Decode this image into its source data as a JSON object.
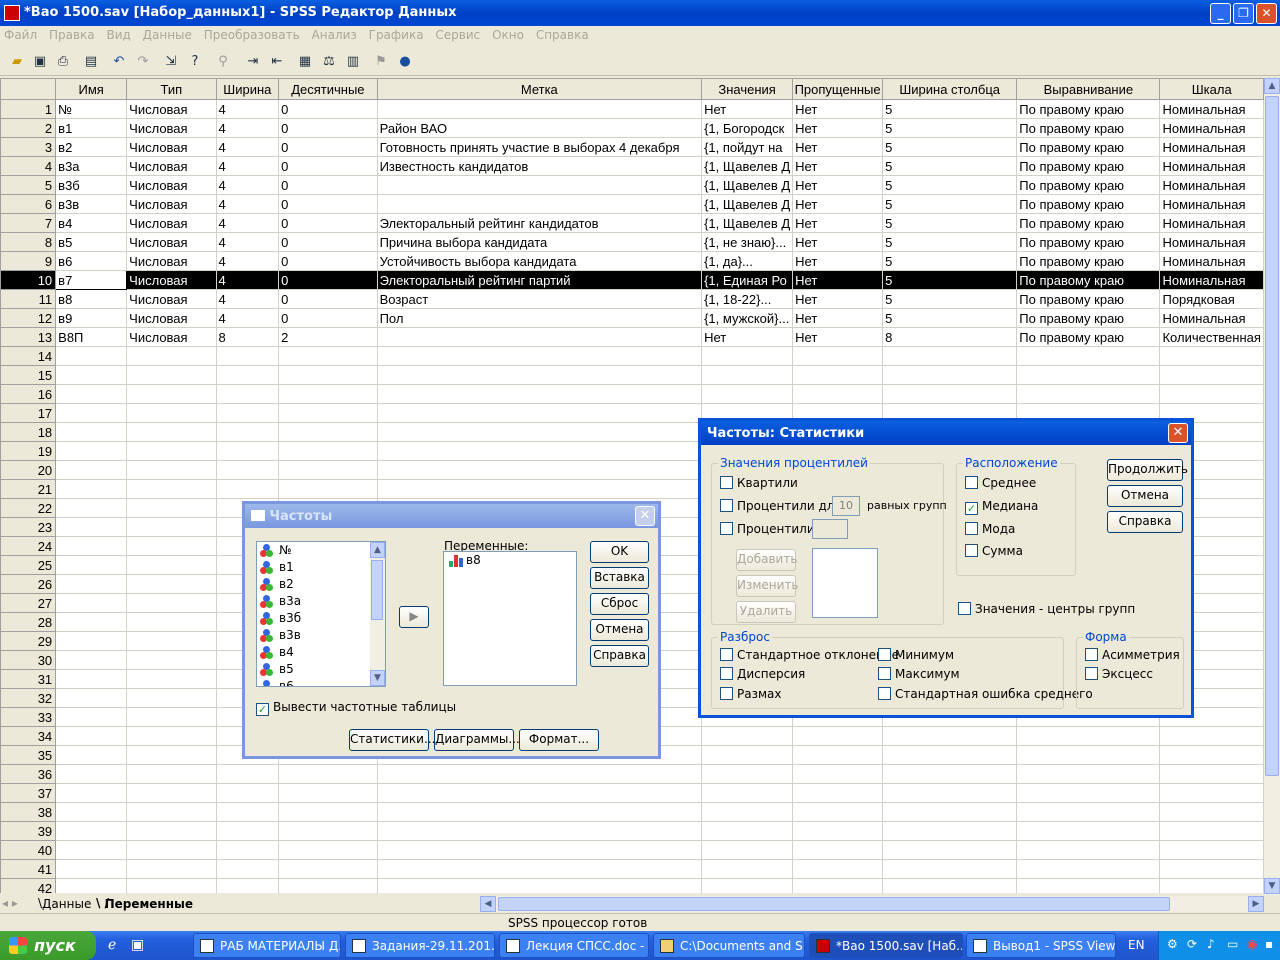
{
  "window": {
    "title": "*Вао 1500.sav [Набор_данных1] - SPSS Редактор Данных"
  },
  "menu": [
    "Файл",
    "Правка",
    "Вид",
    "Данные",
    "Преобразовать",
    "Анализ",
    "Графика",
    "Сервис",
    "Окно",
    "Справка"
  ],
  "grid": {
    "columns": [
      "Имя",
      "Тип",
      "Ширина",
      "Десятичные",
      "Метка",
      "Значения",
      "Пропущенные",
      "Ширина столбца",
      "Выравнивание",
      "Шкала"
    ],
    "rows": [
      [
        "1",
        "№",
        "Числовая",
        "4",
        "0",
        "",
        "Нет",
        "Нет",
        "5",
        "По правому краю",
        "Номинальная"
      ],
      [
        "2",
        "в1",
        "Числовая",
        "4",
        "0",
        "Район ВАО",
        "{1, Богородск",
        "Нет",
        "5",
        "По правому краю",
        "Номинальная"
      ],
      [
        "3",
        "в2",
        "Числовая",
        "4",
        "0",
        "Готовность принять участие в выборах 4 декабря",
        "{1, пойдут на",
        "Нет",
        "5",
        "По правому краю",
        "Номинальная"
      ],
      [
        "4",
        "в3а",
        "Числовая",
        "4",
        "0",
        "Известность  кандидатов",
        "{1, Щавелев Д",
        "Нет",
        "5",
        "По правому краю",
        "Номинальная"
      ],
      [
        "5",
        "в3б",
        "Числовая",
        "4",
        "0",
        "",
        "{1, Щавелев Д",
        "Нет",
        "5",
        "По правому краю",
        "Номинальная"
      ],
      [
        "6",
        "в3в",
        "Числовая",
        "4",
        "0",
        "",
        "{1, Щавелев Д",
        "Нет",
        "5",
        "По правому краю",
        "Номинальная"
      ],
      [
        "7",
        "в4",
        "Числовая",
        "4",
        "0",
        "Электоральный рейтинг кандидатов",
        "{1, Щавелев Д",
        "Нет",
        "5",
        "По правому краю",
        "Номинальная"
      ],
      [
        "8",
        "в5",
        "Числовая",
        "4",
        "0",
        "Причина выбора кандидата",
        "{1, не знаю}...",
        "Нет",
        "5",
        "По правому краю",
        "Номинальная"
      ],
      [
        "9",
        "в6",
        "Числовая",
        "4",
        "0",
        "Устойчивость выбора кандидата",
        "{1, да}...",
        "Нет",
        "5",
        "По правому краю",
        "Номинальная"
      ],
      [
        "10",
        "в7",
        "Числовая",
        "4",
        "0",
        "Электоральный рейтинг партий",
        "{1, Единая Ро",
        "Нет",
        "5",
        "По правому краю",
        "Номинальная"
      ],
      [
        "11",
        "в8",
        "Числовая",
        "4",
        "0",
        "Возраст",
        "{1, 18-22}...",
        "Нет",
        "5",
        "По правому краю",
        "Порядковая"
      ],
      [
        "12",
        "в9",
        "Числовая",
        "4",
        "0",
        "Пол",
        "{1, мужской}...",
        "Нет",
        "5",
        "По правому краю",
        "Номинальная"
      ],
      [
        "13",
        "В8П",
        "Числовая",
        "8",
        "2",
        "",
        "Нет",
        "Нет",
        "8",
        "По правому краю",
        "Количественная"
      ]
    ],
    "empty_row_numbers": [
      "14",
      "15",
      "16",
      "17",
      "18",
      "19",
      "20",
      "21",
      "22",
      "23",
      "24",
      "25",
      "26",
      "27",
      "28",
      "29",
      "30",
      "31",
      "32",
      "33",
      "34",
      "35",
      "36",
      "37",
      "38",
      "39",
      "40",
      "41",
      "42"
    ],
    "selected_row": "10"
  },
  "tabs": {
    "data": "Данные",
    "variables": "Переменные"
  },
  "status": "SPSS процессор готов",
  "freq_dialog": {
    "title": "Частоты",
    "source_vars": [
      "№",
      "в1",
      "в2",
      "в3а",
      "в3б",
      "в3в",
      "в4",
      "в5",
      "в6"
    ],
    "target_label": "Переменные:",
    "target_vars": [
      "в8"
    ],
    "buttons": [
      "OK",
      "Вставка",
      "Сброс",
      "Отмена",
      "Справка"
    ],
    "show_tables": "Вывести частотные таблицы",
    "bottom_buttons": [
      "Статистики...",
      "Диаграммы...",
      "Формат..."
    ]
  },
  "stats_dialog": {
    "title": "Частоты: Статистики",
    "percentile_group": "Значения процентилей",
    "quartiles": "Квартили",
    "cut_points": "Процентили для:",
    "cut_value": "10",
    "equal_groups": "равных групп",
    "percentiles": "Процентили:",
    "add": "Добавить",
    "change": "Изменить",
    "remove": "Удалить",
    "location_group": "Расположение",
    "mean": "Среднее",
    "median": "Медиана",
    "mode": "Мода",
    "sum": "Сумма",
    "group_midpoints": "Значения - центры групп",
    "dispersion_group": "Разброс",
    "std_dev": "Стандартное отклонение",
    "variance": "Дисперсия",
    "range": "Размах",
    "minimum": "Минимум",
    "maximum": "Максимум",
    "se_mean": "Стандартная ошибка среднего",
    "distribution_group": "Форма",
    "skewness": "Асимметрия",
    "kurtosis": "Эксцесс",
    "continue": "Продолжить",
    "cancel": "Отмена",
    "help": "Справка"
  },
  "taskbar": {
    "start": "пуск",
    "items": [
      "РАБ МАТЕРИАЛЫ Д...",
      "Задания-29.11.201...",
      "Лекция СПСС.doc - ...",
      "C:\\Documents and S...",
      "*Вао 1500.sav [Наб...",
      "Вывод1 - SPSS Viewer"
    ],
    "language": "EN"
  }
}
